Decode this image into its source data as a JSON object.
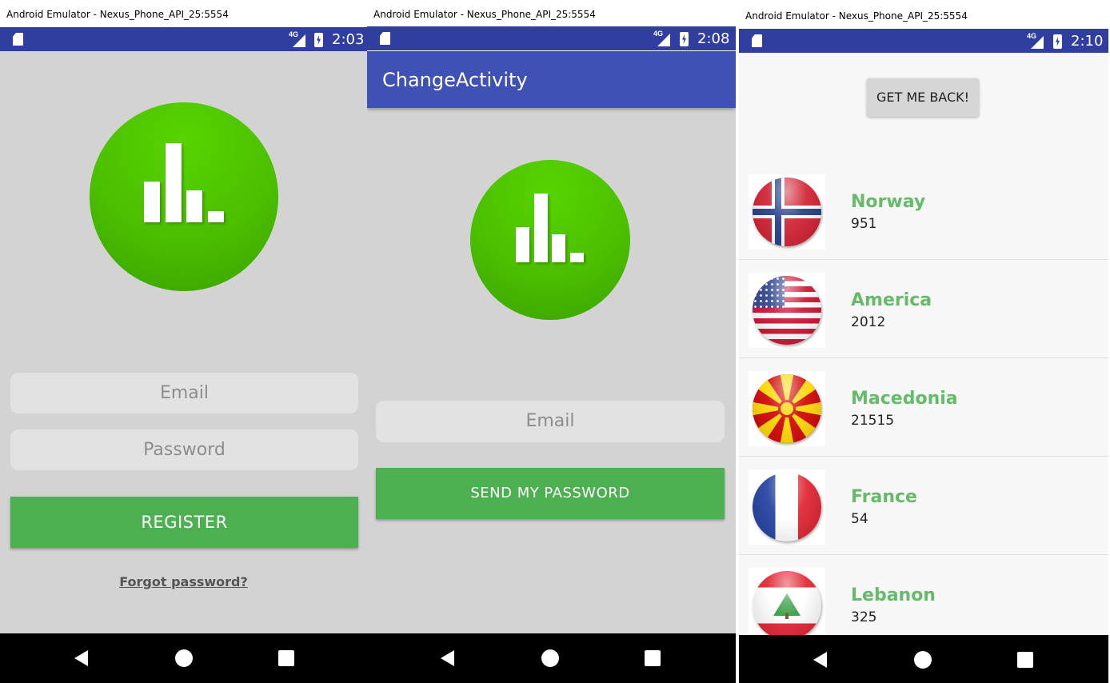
{
  "screens": [
    {
      "window_title": "Android Emulator - Nexus_Phone_API_25:5554",
      "status": {
        "network": "4G",
        "time": "2:03"
      },
      "email_placeholder": "Email",
      "password_placeholder": "Password",
      "register_label": "REGISTER",
      "forgot_label": "Forgot password?"
    },
    {
      "window_title": "Android Emulator - Nexus_Phone_API_25:5554",
      "status": {
        "network": "4G",
        "time": "2:08"
      },
      "toolbar_title": "ChangeActivity",
      "email_placeholder": "Email",
      "send_label": "SEND MY PASSWORD"
    },
    {
      "window_title": "Android Emulator - Nexus_Phone_API_25:5554",
      "status": {
        "network": "4G",
        "time": "2:10"
      },
      "back_button_label": "GET ME BACK!",
      "countries": [
        {
          "name": "Norway",
          "count": "951",
          "flag": "norway-flag-icon"
        },
        {
          "name": "America",
          "count": "2012",
          "flag": "usa-flag-icon"
        },
        {
          "name": "Macedonia",
          "count": "21515",
          "flag": "macedonia-flag-icon"
        },
        {
          "name": "France",
          "count": "54",
          "flag": "france-flag-icon"
        },
        {
          "name": "Lebanon",
          "count": "325",
          "flag": "lebanon-flag-icon"
        }
      ]
    }
  ],
  "colors": {
    "status_bar": "#303f9f",
    "toolbar": "#3f51b5",
    "accent_green": "#4caf50",
    "country_name_green": "#66bb6a",
    "logo_green": "#4bbf00"
  }
}
